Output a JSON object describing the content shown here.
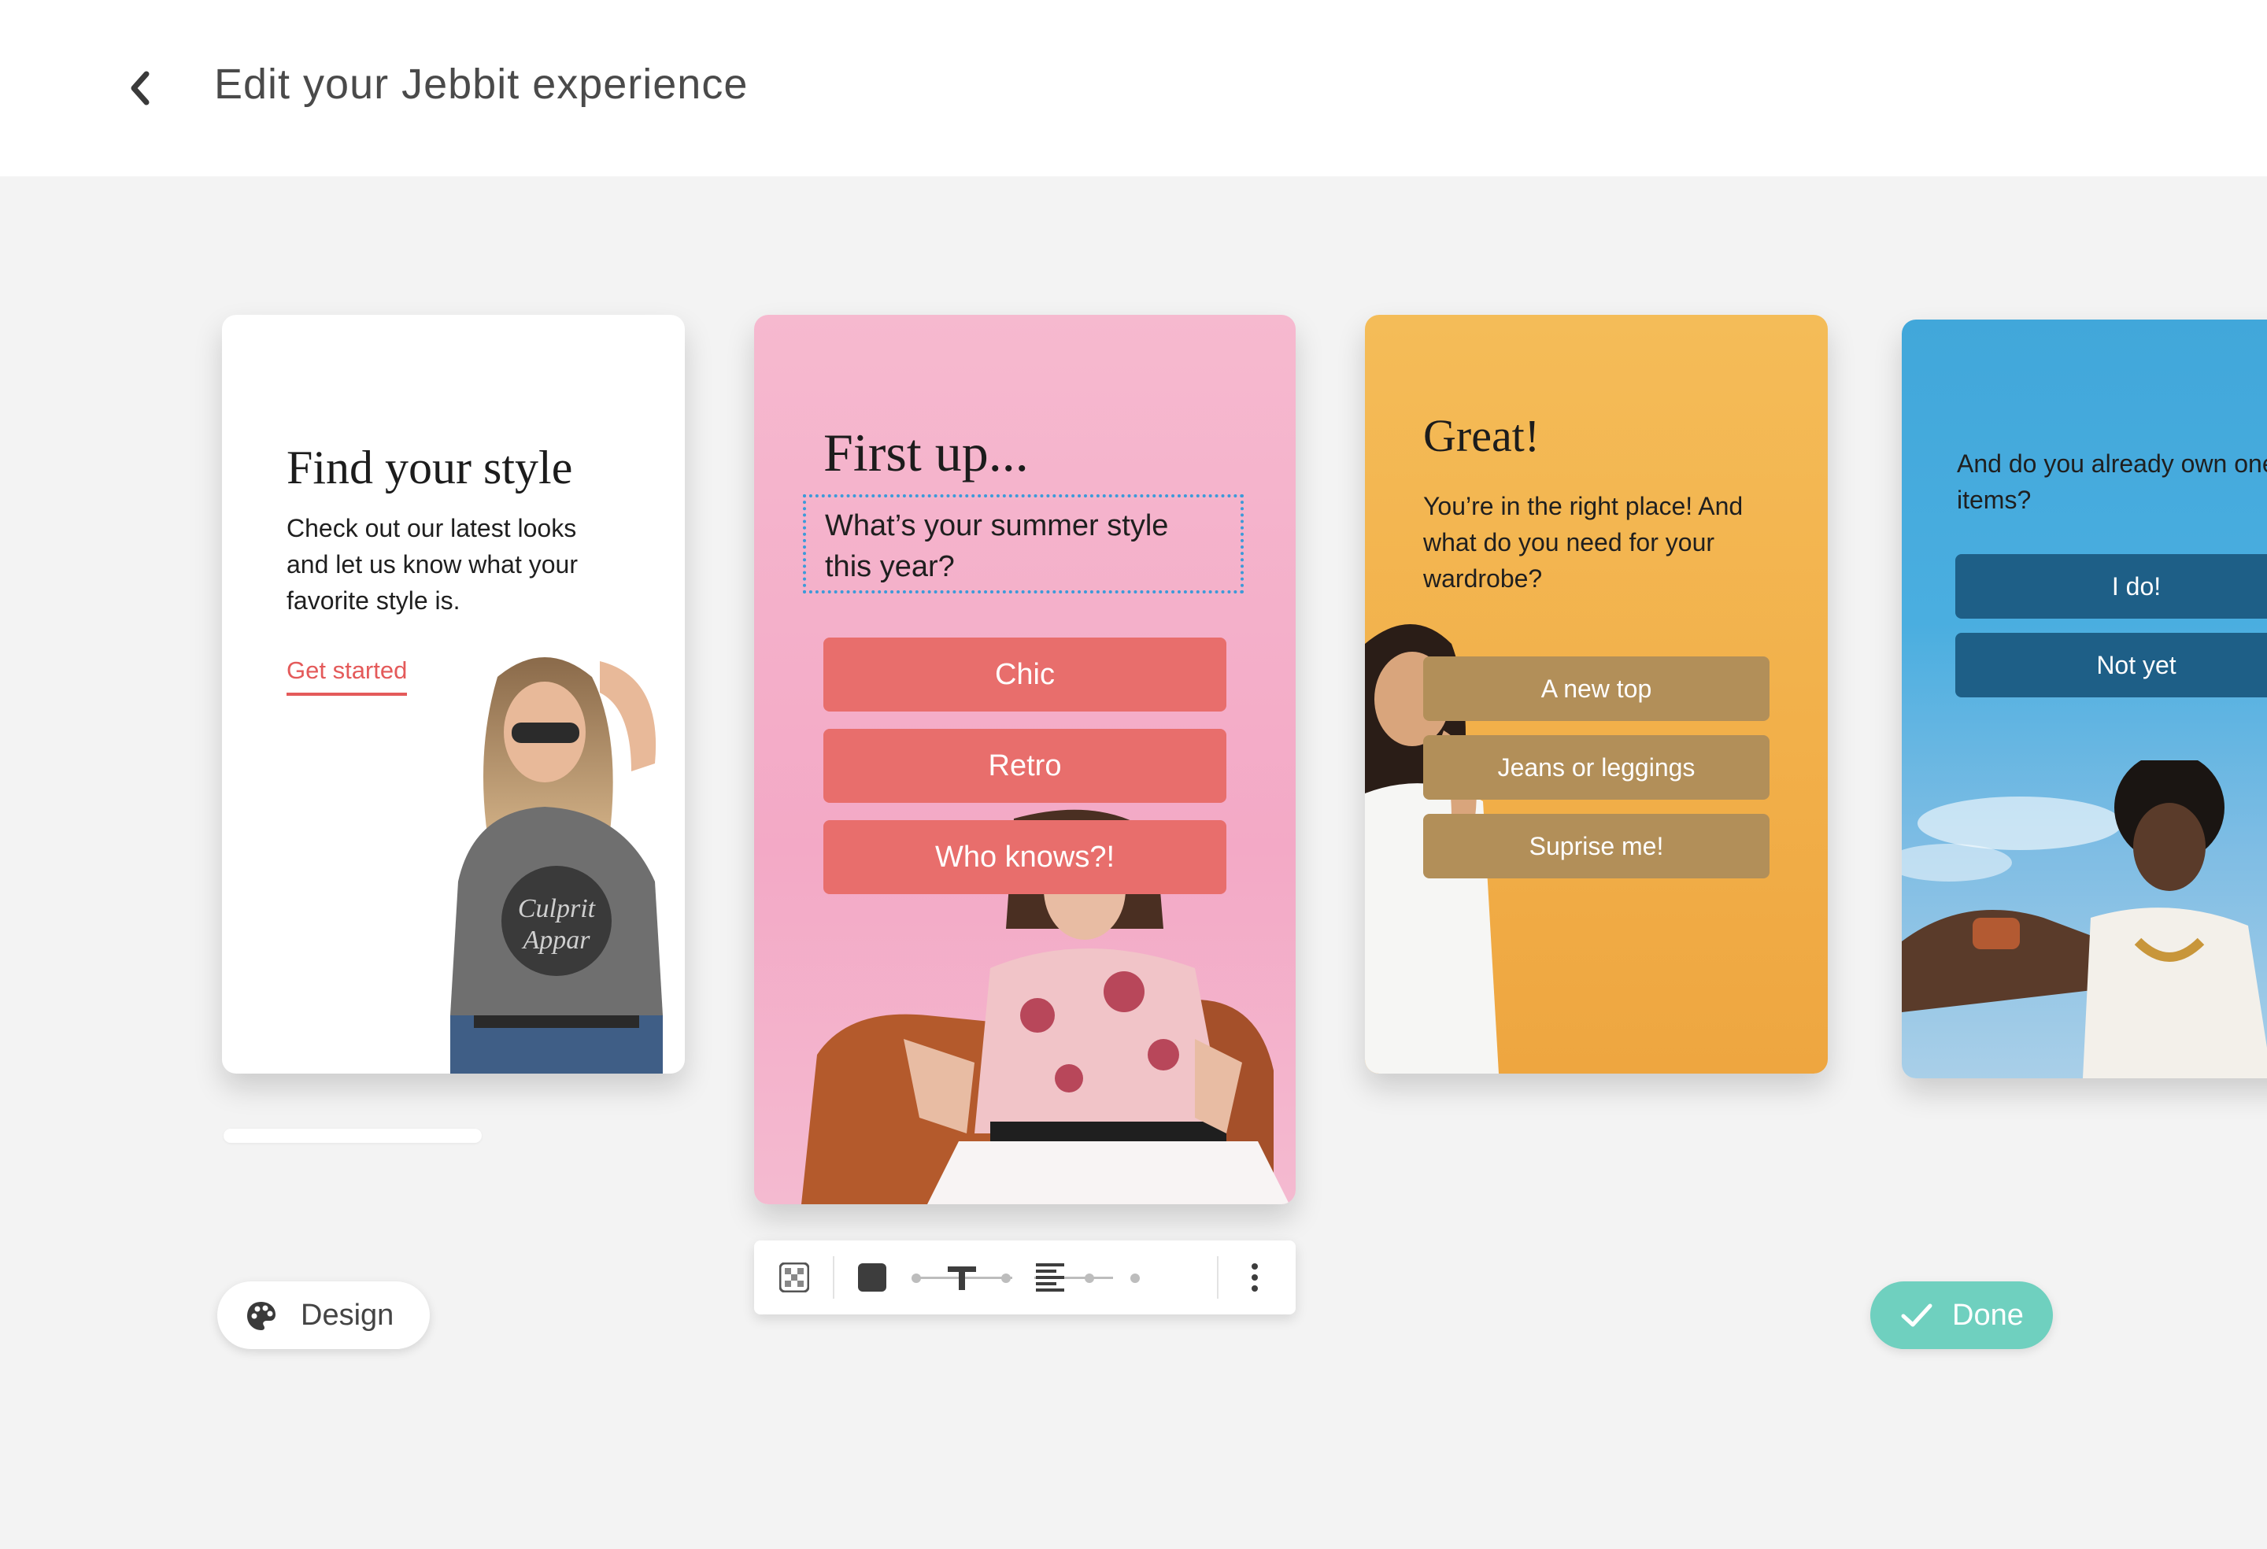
{
  "header": {
    "title": "Edit your Jebbit experience",
    "back_icon": "chevron-left-icon"
  },
  "cards": [
    {
      "title": "Find your style",
      "body": "Check out our latest looks and let us know what your favorite style is.",
      "link": "Get started",
      "link_color": "#e45a5a",
      "background": "#ffffff"
    },
    {
      "title": "First up...",
      "question": "What’s your summer style this year?",
      "options": [
        "Chic",
        "Retro",
        "Who knows?!"
      ],
      "button_color": "#e86e6c",
      "background": "#f6b9cf"
    },
    {
      "title": "Great!",
      "body": "You’re in the right place! And what do you need for your wardrobe?",
      "options": [
        "A new top",
        "Jeans or leggings",
        "Suprise me!"
      ],
      "button_color": "#b28f59",
      "background": "#f4bc58"
    },
    {
      "body": "And do you already own one of our items?",
      "options": [
        "I do!",
        "Not yet"
      ],
      "button_color": "#1e5f87",
      "background": "#41a7da"
    }
  ],
  "toolbar": {
    "icons": [
      "transparency-icon",
      "fill-color-icon",
      "text-size-icon",
      "text-align-icon",
      "more-vertical-icon"
    ]
  },
  "actions": {
    "design_label": "Design",
    "design_icon": "palette-icon",
    "done_label": "Done",
    "done_icon": "check-icon",
    "done_color": "#6fd0bf"
  }
}
